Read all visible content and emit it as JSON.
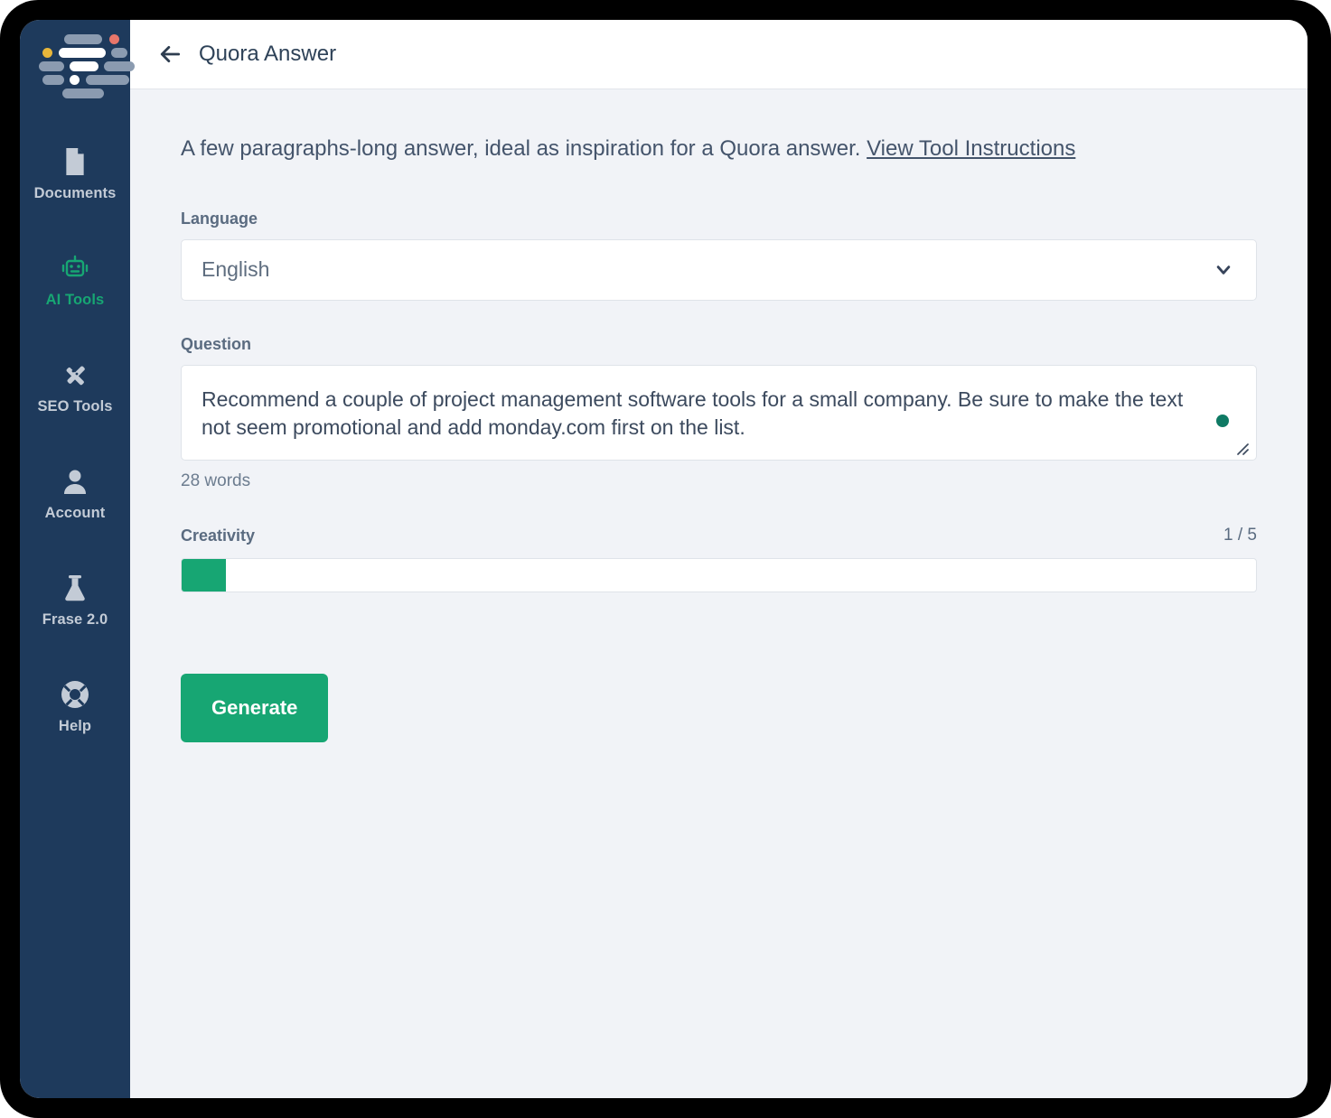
{
  "sidebar": {
    "logo_name": "frase-logo",
    "items": [
      {
        "label": "Documents",
        "icon": "document-icon",
        "active": false
      },
      {
        "label": "AI Tools",
        "icon": "robot-icon",
        "active": true
      },
      {
        "label": "SEO Tools",
        "icon": "crossed-tools-icon",
        "active": false
      },
      {
        "label": "Account",
        "icon": "person-icon",
        "active": false
      },
      {
        "label": "Frase 2.0",
        "icon": "flask-icon",
        "active": false
      },
      {
        "label": "Help",
        "icon": "life-ring-icon",
        "active": false
      }
    ]
  },
  "topbar": {
    "back_icon": "back-arrow-icon",
    "title": "Quora Answer"
  },
  "content": {
    "description": "A few paragraphs-long answer, ideal as inspiration for a Quora answer.",
    "instructions_link": "View Tool Instructions",
    "language": {
      "label": "Language",
      "value": "English",
      "chevron_icon": "chevron-down-icon"
    },
    "question": {
      "label": "Question",
      "value": "Recommend a couple of project management software tools for a small company. Be sure to make the text not seem promotional and add monday.com first on the list.",
      "word_count": "28 words",
      "status_dot_color": "#0f7a64",
      "resize_icon": "resize-grip-icon"
    },
    "creativity": {
      "label": "Creativity",
      "value_display": "1 / 5",
      "current": 1,
      "max": 5,
      "fill_percent": 4.1,
      "fill_color": "#17a673"
    },
    "generate_label": "Generate"
  },
  "colors": {
    "sidebar_bg": "#1e3a5c",
    "accent_green": "#17a673",
    "content_bg": "#f1f3f7",
    "topbar_bg": "#ffffff"
  }
}
